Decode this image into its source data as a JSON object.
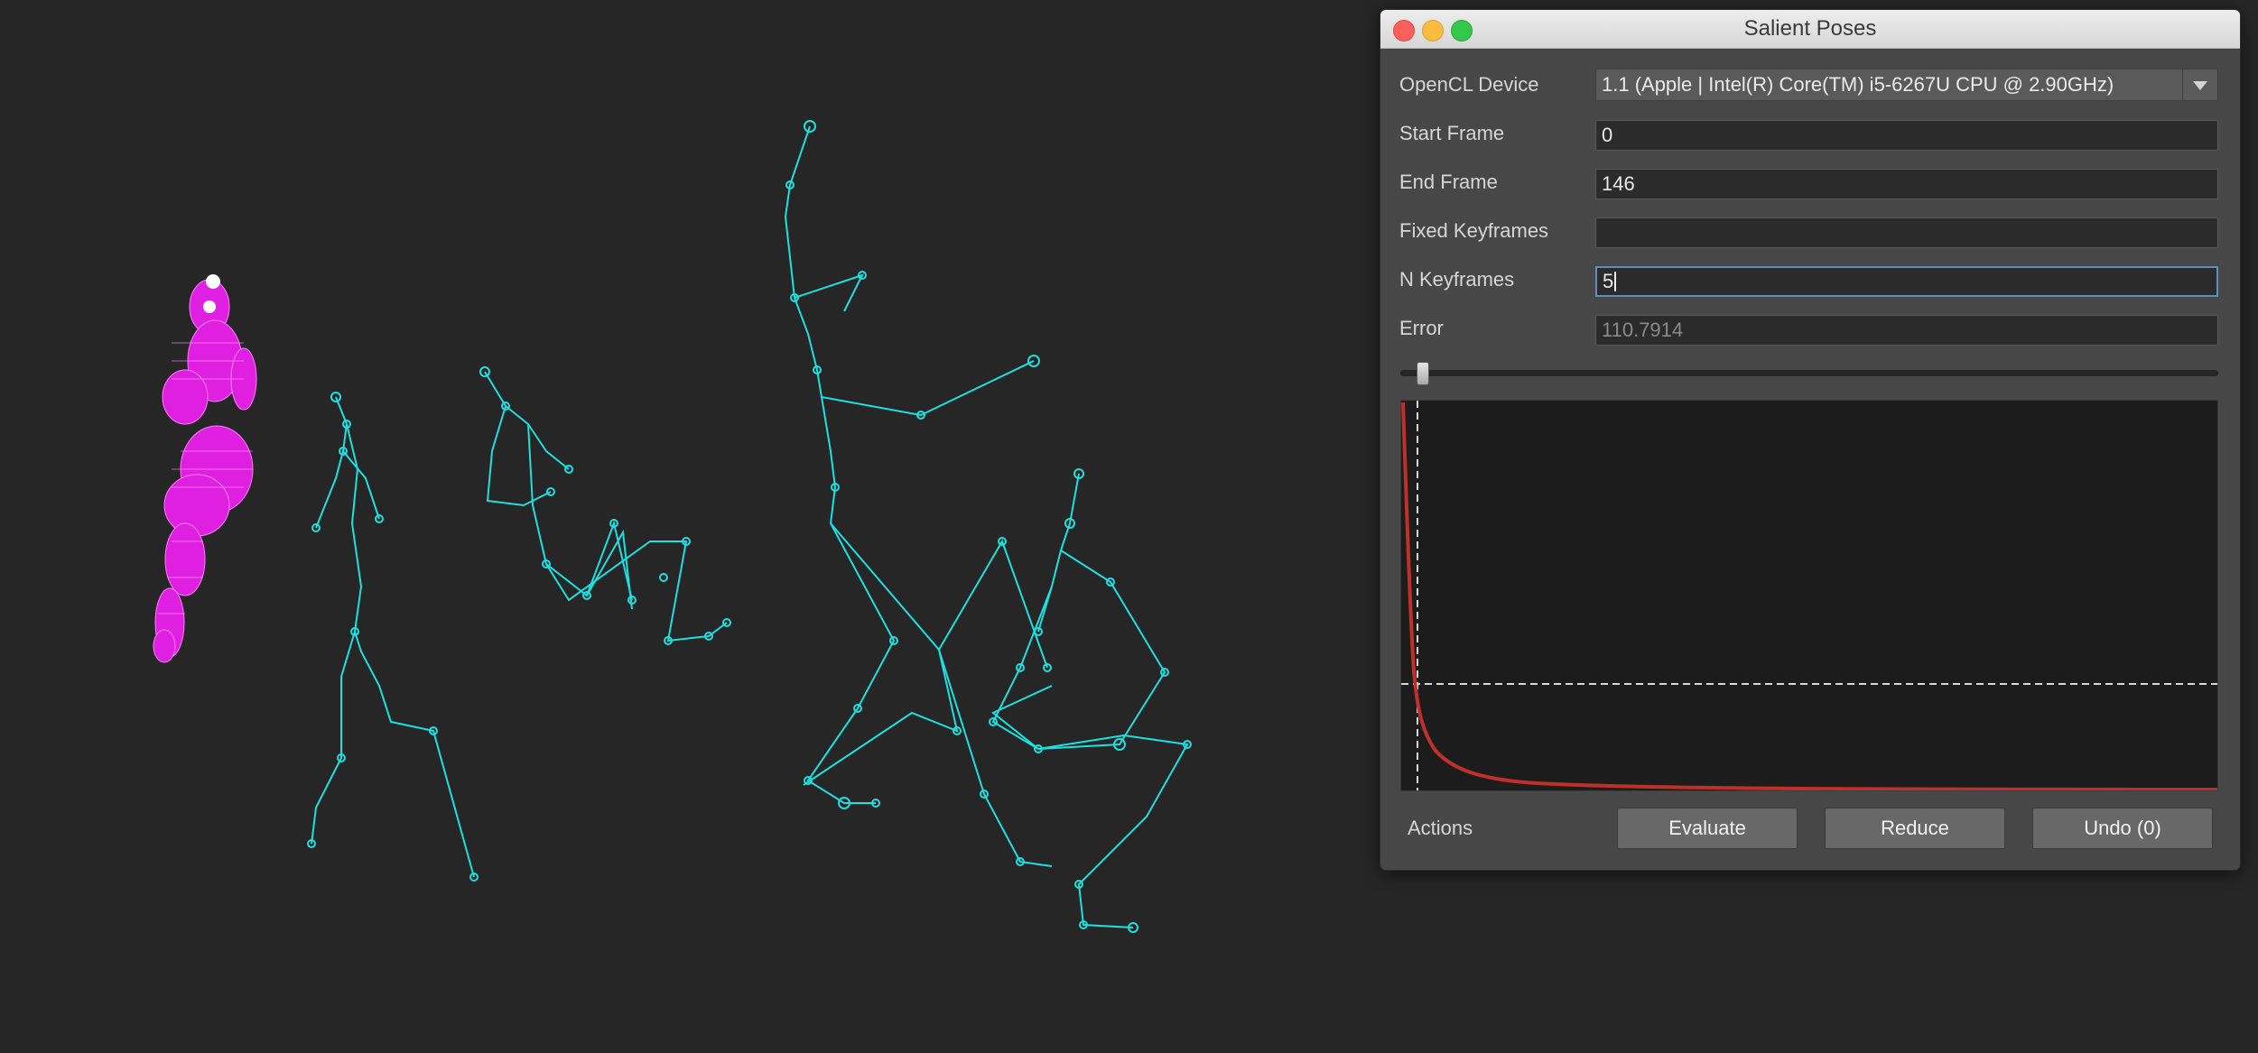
{
  "window": {
    "title": "Salient Poses"
  },
  "form": {
    "opencl_device_label": "OpenCL Device",
    "opencl_device_value": "1.1 (Apple | Intel(R) Core(TM) i5-6267U CPU @ 2.90GHz)",
    "start_frame_label": "Start Frame",
    "start_frame_value": "0",
    "end_frame_label": "End Frame",
    "end_frame_value": "146",
    "fixed_keyframes_label": "Fixed Keyframes",
    "fixed_keyframes_value": "",
    "n_keyframes_label": "N Keyframes",
    "n_keyframes_value": "5",
    "error_label": "Error",
    "error_value": "110.7914"
  },
  "slider": {
    "fraction": 0.02
  },
  "actions": {
    "label": "Actions",
    "evaluate": "Evaluate",
    "reduce": "Reduce",
    "undo": "Undo (0)"
  },
  "colors": {
    "curve": "#c0302b",
    "skeleton": "#1fe0e0",
    "mesh": "#e020e0"
  }
}
